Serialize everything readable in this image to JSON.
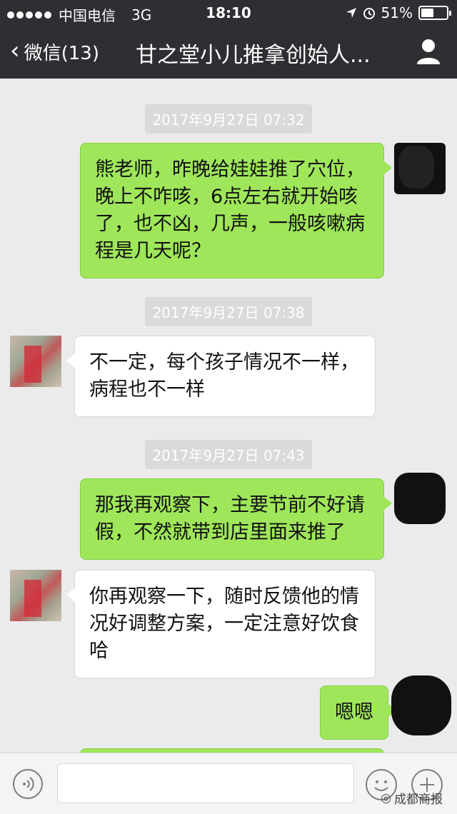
{
  "status_bar": {
    "carrier": "中国电信",
    "network": "3G",
    "time": "18:10",
    "battery": "51%",
    "battery_level": 0.51
  },
  "nav": {
    "back_label": "微信(13)",
    "title": "甘之堂小儿推拿创始人..."
  },
  "messages": [
    {
      "type": "timestamp",
      "text": "2017年9月27日 07:32"
    },
    {
      "type": "sent",
      "text": "熊老师，昨晚给娃娃推了穴位，晚上不咋咳，6点左右就开始咳了，也不凶，几声，一般咳嗽病程是几天呢？"
    },
    {
      "type": "timestamp",
      "text": "2017年9月27日 07:38"
    },
    {
      "type": "received",
      "text": "不一定，每个孩子情况不一样，病程也不一样"
    },
    {
      "type": "timestamp",
      "text": "2017年9月27日 07:43"
    },
    {
      "type": "sent",
      "text": "那我再观察下，主要节前不好请假，不然就带到店里面来推了"
    },
    {
      "type": "received",
      "text": "你再观察一下，随时反馈他的情况好调整方案，一定注意好饮食哈"
    },
    {
      "type": "sent",
      "text": "嗯嗯"
    }
  ],
  "input_bar": {
    "placeholder": "",
    "watermark": "成都商报"
  },
  "colors": {
    "bar_bg": "#2e2e33",
    "sent_bubble": "#9fe65a",
    "received_bubble": "#ffffff",
    "chat_bg": "#ebebeb"
  },
  "icons": {
    "back": "chevron-left-icon",
    "profile": "person-icon",
    "voice": "voice-icon",
    "emoji": "smiley-icon",
    "plus": "plus-icon"
  }
}
